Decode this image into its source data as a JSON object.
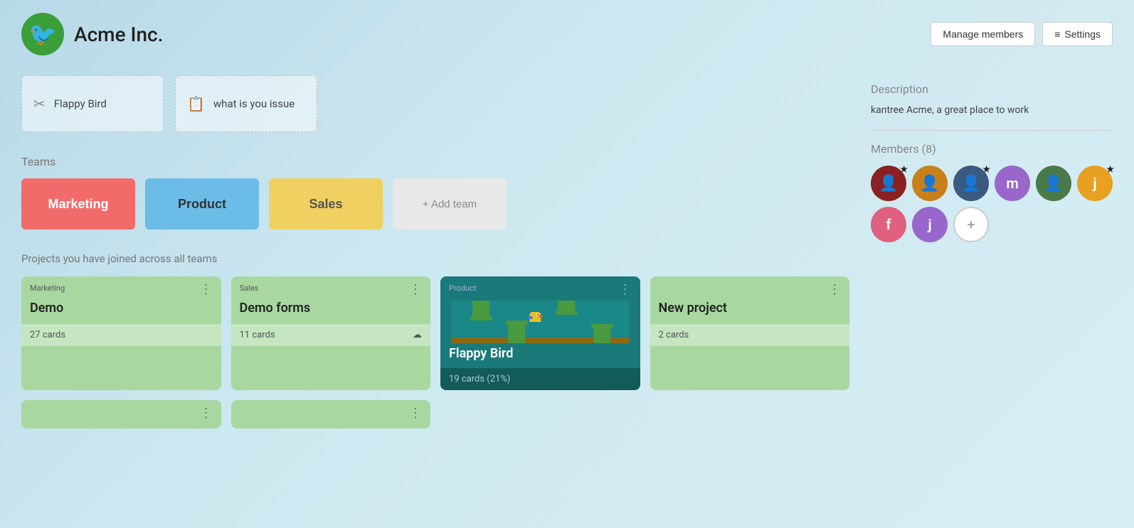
{
  "header": {
    "org_name": "Acme Inc.",
    "manage_members_label": "Manage members",
    "settings_label": "Settings"
  },
  "recent_boards": [
    {
      "id": "flappy-bird",
      "label": "Flappy Bird",
      "icon": "✂"
    },
    {
      "id": "what-is-you-issue",
      "label": "what is you issue",
      "icon": "📋"
    }
  ],
  "teams_section": {
    "title": "Teams",
    "teams": [
      {
        "id": "marketing",
        "label": "Marketing",
        "color_class": "marketing"
      },
      {
        "id": "product",
        "label": "Product",
        "color_class": "product"
      },
      {
        "id": "sales",
        "label": "Sales",
        "color_class": "sales"
      },
      {
        "id": "add-team",
        "label": "+ Add team",
        "color_class": "add"
      }
    ]
  },
  "projects_section": {
    "title": "Projects you have joined across all teams",
    "projects": [
      {
        "id": "marketing-demo",
        "team": "Marketing",
        "name": "Demo",
        "cards": "27 cards",
        "type": "normal"
      },
      {
        "id": "sales-demo-forms",
        "team": "Sales",
        "name": "Demo forms",
        "cards": "11 cards",
        "type": "normal",
        "has_upload": true
      },
      {
        "id": "product-flappy-bird",
        "team": "Product",
        "name": "Flappy Bird",
        "cards": "19 cards (21%)",
        "type": "flappy"
      },
      {
        "id": "new-project",
        "team": "",
        "name": "New project",
        "cards": "2 cards",
        "type": "normal"
      }
    ]
  },
  "sidebar": {
    "description_title": "Description",
    "description_text": "kantree Acme, a great place to work",
    "members_title": "Members (8)",
    "members": [
      {
        "id": "m1",
        "bg": "#8B2020",
        "letter": "",
        "is_photo": true,
        "has_star": true
      },
      {
        "id": "m2",
        "bg": "#d4a020",
        "letter": "",
        "is_photo": true,
        "has_star": false
      },
      {
        "id": "m3",
        "bg": "#405080",
        "letter": "",
        "is_photo": true,
        "has_star": true
      },
      {
        "id": "m4",
        "bg": "#9966cc",
        "letter": "m",
        "is_photo": false,
        "has_star": false
      },
      {
        "id": "m5",
        "bg": "#4a7a4a",
        "letter": "",
        "is_photo": true,
        "has_star": false
      },
      {
        "id": "m6",
        "bg": "#e8a020",
        "letter": "j",
        "is_photo": false,
        "has_star": true
      },
      {
        "id": "m7",
        "bg": "#e06080",
        "letter": "f",
        "is_photo": false,
        "has_star": false
      },
      {
        "id": "m8",
        "bg": "#9966cc",
        "letter": "j",
        "is_photo": false,
        "has_star": false
      }
    ]
  }
}
